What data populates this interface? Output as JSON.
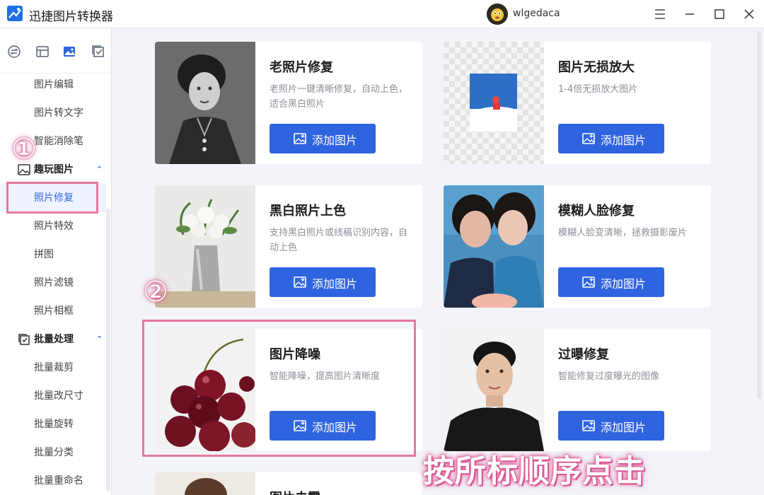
{
  "app": {
    "title": "迅捷图片转换器",
    "username": "wlgedaca"
  },
  "sidebar": {
    "top_icons": [
      "convert-icon",
      "layout-icon",
      "image-icon",
      "checkbox-icon"
    ],
    "items": [
      {
        "label": "图片编辑"
      },
      {
        "label": "图片转文字"
      },
      {
        "label": "智能消除笔"
      }
    ],
    "group_fun": {
      "label": "趣玩图片",
      "icon": "image-icon",
      "caret": "⌃"
    },
    "fun_items": [
      {
        "label": "照片修复",
        "active": true
      },
      {
        "label": "照片特效"
      },
      {
        "label": "拼图"
      },
      {
        "label": "照片滤镜"
      },
      {
        "label": "照片相框"
      }
    ],
    "group_batch": {
      "label": "批量处理",
      "icon": "checkbox-icon",
      "caret": "⌃"
    },
    "batch_items": [
      {
        "label": "批量裁剪"
      },
      {
        "label": "批量改尺寸"
      },
      {
        "label": "批量旋转"
      },
      {
        "label": "批量分类"
      },
      {
        "label": "批量重命名"
      }
    ]
  },
  "cards": [
    {
      "title": "老照片修复",
      "desc": "老照片一键清晰修复，自动上色，适合黑白照片",
      "button": "添加图片"
    },
    {
      "title": "图片无损放大",
      "desc": "1-4倍无损放大图片",
      "button": "添加图片"
    },
    {
      "title": "黑白照片上色",
      "desc": "支持黑白照片或线稿识别内容，自动上色",
      "button": "添加图片"
    },
    {
      "title": "模糊人脸修复",
      "desc": "模糊人脸变清晰，拯救摄影废片",
      "button": "添加图片"
    },
    {
      "title": "图片降噪",
      "desc": "智能降噪，提高图片清晰度",
      "button": "添加图片"
    },
    {
      "title": "过曝修复",
      "desc": "智能修复过度曝光的图像",
      "button": "添加图片"
    },
    {
      "title": "图片去雾"
    }
  ],
  "annotations": {
    "step1": "①",
    "step2": "②",
    "hint": "按所标顺序点击"
  },
  "colors": {
    "accent": "#2f64e0",
    "annotation": "#e8779c",
    "active_bg": "#eef3fd"
  }
}
